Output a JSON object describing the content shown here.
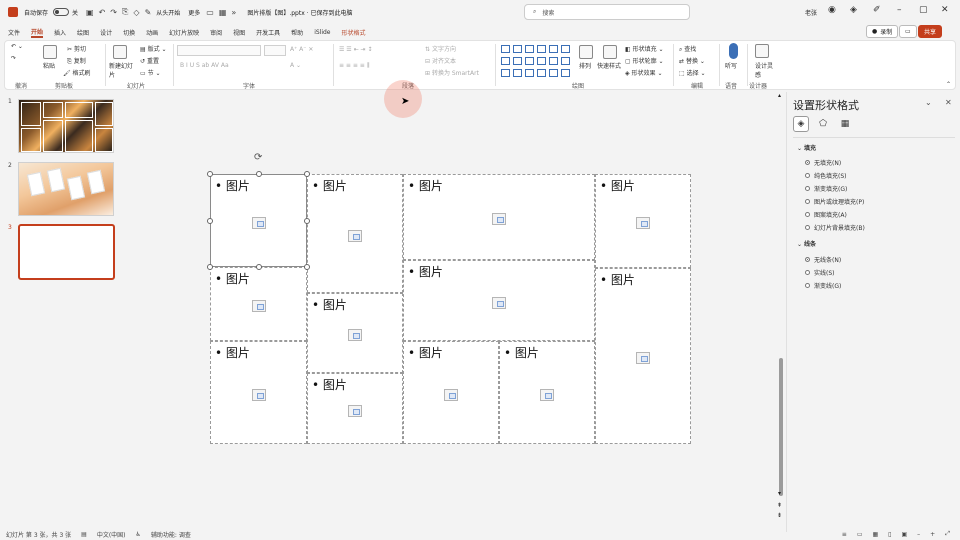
{
  "titlebar": {
    "autosave_label": "自动保存",
    "autosave_state": "关",
    "present_label": "从头开始",
    "more_label": "更多",
    "doc_title": "图片排版【图】.pptx · 已保存到此电脑",
    "search_placeholder": "搜索",
    "user": "老张"
  },
  "menu": {
    "tabs": [
      "文件",
      "开始",
      "插入",
      "绘图",
      "设计",
      "切换",
      "动画",
      "幻灯片放映",
      "审阅",
      "视图",
      "开发工具",
      "帮助",
      "iSlide"
    ],
    "active_index": 1,
    "context_tab": "形状格式",
    "record_label": "录制",
    "share_label": "共享"
  },
  "ribbon": {
    "groups": [
      "剪贴板",
      "幻灯片",
      "字体",
      "段落",
      "绘图",
      "编辑",
      "语音",
      "设计器"
    ],
    "clipboard": {
      "paste": "粘贴",
      "cut": "剪切",
      "copy": "复制",
      "format_painter": "格式刷"
    },
    "slides": {
      "new": "新建幻灯片",
      "layout": "版式",
      "reset": "重置",
      "section": "节"
    },
    "paragraph": {
      "text_direction": "文字方向",
      "align_text": "对齐文本",
      "smartart": "转换为 SmartArt"
    },
    "drawing": {
      "arrange": "排列",
      "quick_styles": "快速样式",
      "shape_fill": "形状填充",
      "shape_outline": "形状轮廓",
      "shape_effects": "形状效果"
    },
    "editing": {
      "find": "查找",
      "replace": "替换",
      "select": "选择"
    },
    "voice": {
      "dictate": "听写"
    },
    "designer": {
      "ideas": "设计灵感"
    }
  },
  "thumbnails": [
    {
      "number": "1",
      "selected": false
    },
    {
      "number": "2",
      "selected": false
    },
    {
      "number": "3",
      "selected": true
    }
  ],
  "slide": {
    "placeholder_label": "图片",
    "placeholder_count": 12
  },
  "format_pane": {
    "title": "设置形状格式",
    "fill_section": "填充",
    "fill_options": [
      "无填充(N)",
      "纯色填充(S)",
      "渐变填充(G)",
      "图片或纹理填充(P)",
      "图案填充(A)",
      "幻灯片背景填充(B)"
    ],
    "fill_selected": 0,
    "line_section": "线条",
    "line_options": [
      "无线条(N)",
      "实线(S)",
      "渐变线(G)"
    ],
    "line_selected": 0
  },
  "status": {
    "slide_pos": "幻灯片 第 3 张，共 3 张",
    "language": "中文(中国)",
    "accessibility": "辅助功能: 调查"
  },
  "colors": {
    "accent": "#c43e1c",
    "selection_border": "#c43e1c",
    "ribbon_icon_blue": "#3b6fb6"
  }
}
